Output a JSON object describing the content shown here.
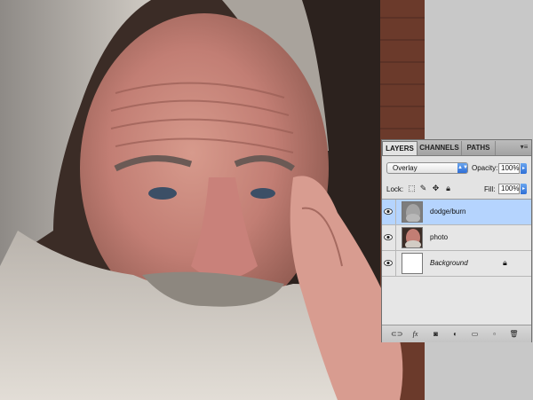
{
  "panel": {
    "tabs": [
      {
        "label": "LAYERS"
      },
      {
        "label": "CHANNELS"
      },
      {
        "label": "PATHS"
      }
    ],
    "blend_mode": "Overlay",
    "opacity_label": "Opacity:",
    "opacity_value": "100%",
    "lock_label": "Lock:",
    "fill_label": "Fill:",
    "fill_value": "100%",
    "layers": [
      {
        "name": "dodge/burn",
        "selected": true,
        "visible": true
      },
      {
        "name": "photo",
        "selected": false,
        "visible": true
      },
      {
        "name": "Background",
        "selected": false,
        "visible": true,
        "locked": true
      }
    ],
    "bottom_icons": [
      "link-layers-icon",
      "fx-icon",
      "add-mask-icon",
      "adjustment-layer-icon",
      "new-group-icon",
      "new-layer-icon",
      "trash-icon"
    ],
    "fx_label": "fx"
  },
  "colors": {
    "selection": "#b5d4fe",
    "accent_blue": "#2f6fd6"
  }
}
